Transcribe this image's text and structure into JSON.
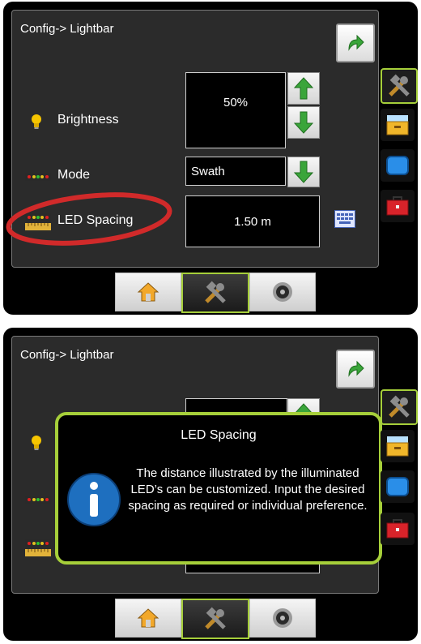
{
  "screens": [
    {
      "title": "Config-> Lightbar",
      "rows": {
        "brightness": {
          "label": "Brightness",
          "value": "50%"
        },
        "mode": {
          "label": "Mode",
          "value": "Swath"
        },
        "led_spacing": {
          "label": "LED Spacing",
          "value": "1.50 m"
        }
      }
    },
    {
      "title": "Config-> Lightbar",
      "dialog": {
        "title": "LED Spacing",
        "message": "The distance illustrated by the illuminated LED’s can be customized. Input the desired spacing as required or individual preference."
      }
    }
  ],
  "icons": {
    "next": "arrow-right-icon",
    "brightness": "lightbulb-icon",
    "mode": "lightbar-leds-icon",
    "led_spacing": "lightbar-ruler-icon",
    "keyboard": "keyboard-icon",
    "info": "info-icon",
    "home": "home-icon",
    "tools": "tools-icon",
    "gauge": "gauge-icon"
  },
  "colors": {
    "accent": "#a6cf3a",
    "highlight_circle": "#d12a2a",
    "arrow_green": "#3aa53a",
    "info_blue": "#1e6fbf"
  }
}
